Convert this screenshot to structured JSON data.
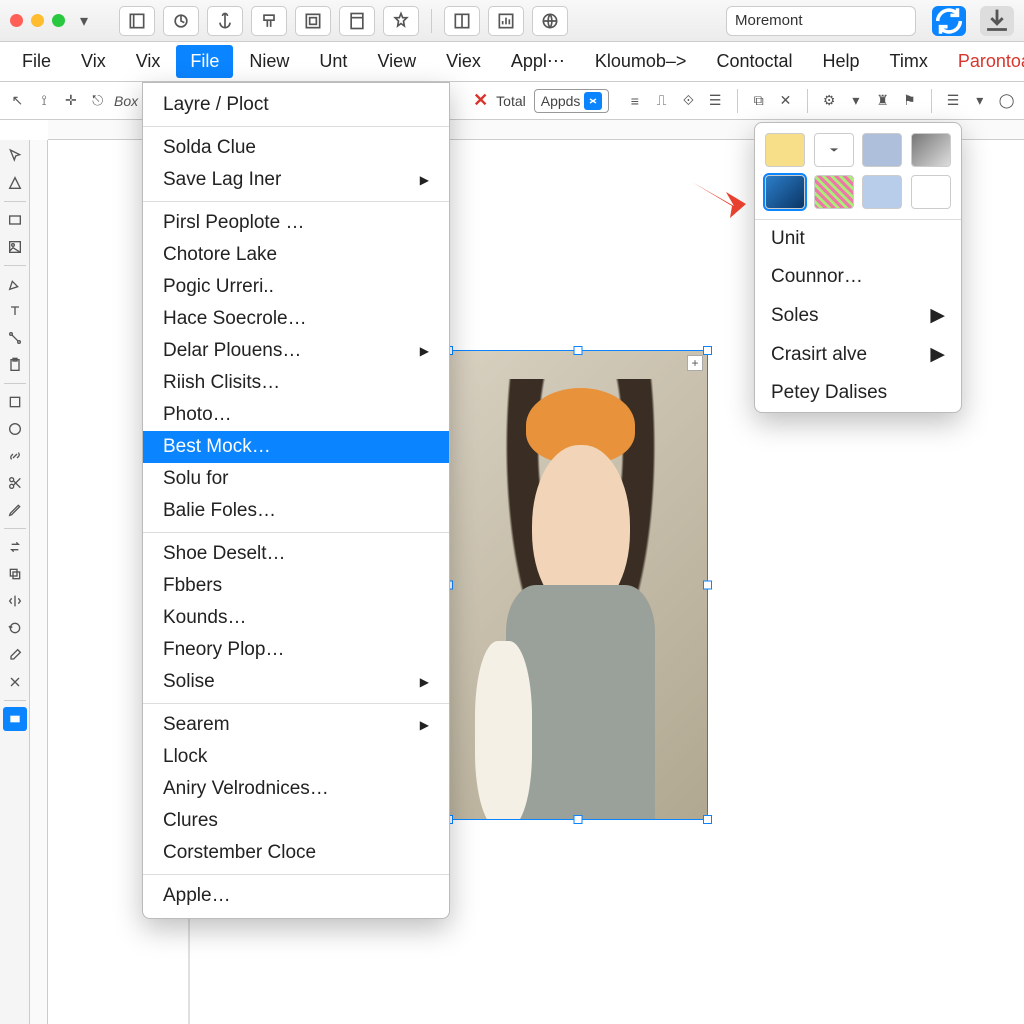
{
  "search": {
    "value": "Moremont"
  },
  "menubar": [
    "File",
    "Vix",
    "Vix",
    "File",
    "Niew",
    "Unt",
    "View",
    "Viex",
    "Appl⋯",
    "Kloumob–>",
    "Contoctal",
    "Help",
    "Timx",
    "Parontoad"
  ],
  "menubar_active_index": 3,
  "menubar_red_index": 13,
  "optbar": {
    "total": "Total",
    "appds": "Appds"
  },
  "file_menu": {
    "groups": [
      [
        {
          "l": "Layre / Ploct"
        }
      ],
      [
        {
          "l": "Solda Clue"
        },
        {
          "l": "Save Lag Iner",
          "sub": true
        }
      ],
      [
        {
          "l": "Pirsl Peoplote …"
        },
        {
          "l": "Chotore Lake"
        },
        {
          "l": "Pogic Urreri.."
        },
        {
          "l": "Hace Soecrole…"
        },
        {
          "l": "Delar Plouens…",
          "sub": true
        },
        {
          "l": "Riish Clisits…"
        },
        {
          "l": "Photo…"
        },
        {
          "l": "Best Mock…",
          "hl": true
        },
        {
          "l": "Solu for"
        },
        {
          "l": "Balie Foles…"
        }
      ],
      [
        {
          "l": "Shoe Deselt…"
        },
        {
          "l": "Fbbers"
        },
        {
          "l": "Kounds…"
        },
        {
          "l": "Fneory Plop…"
        },
        {
          "l": "Solise",
          "sub": true
        }
      ],
      [
        {
          "l": "Searem",
          "sub": true
        },
        {
          "l": "Llock"
        },
        {
          "l": "Aniry Velrodnices…"
        },
        {
          "l": "Clures"
        },
        {
          "l": "Corstember Cloce"
        }
      ],
      [
        {
          "l": "Apple…"
        }
      ]
    ]
  },
  "right_panel": {
    "items": [
      {
        "l": "Unit"
      },
      {
        "l": "Counnor…"
      },
      {
        "l": "Soles",
        "sub": true
      },
      {
        "l": "Crasirt alve",
        "sub": true
      },
      {
        "l": "Petey Dalises"
      }
    ]
  }
}
